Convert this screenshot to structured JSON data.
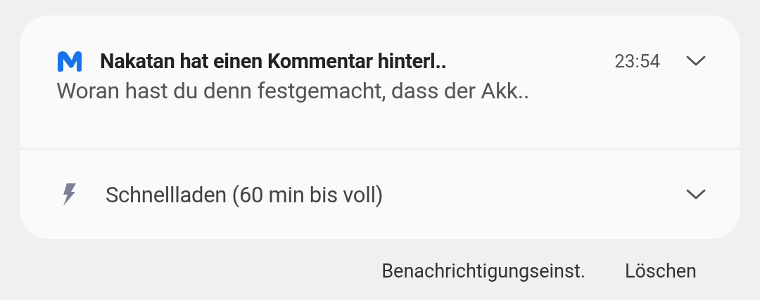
{
  "notifications": [
    {
      "kind": "message",
      "title": "Nakatan hat einen Kommentar hinterl..",
      "time": "23:54",
      "body": "Woran hast du denn festgemacht, dass der Akk..",
      "expanded": false
    },
    {
      "kind": "status",
      "title": "Schnellladen (60 min bis voll)",
      "expanded": false
    }
  ],
  "actions": [
    "Benachrichtigungseinst.",
    "Löschen"
  ]
}
